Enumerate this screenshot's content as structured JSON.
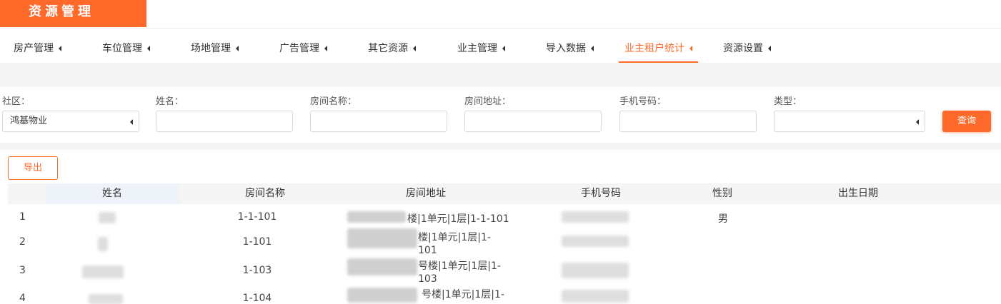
{
  "app": {
    "title": "资源管理"
  },
  "nav": [
    {
      "label": "房产管理",
      "active": false
    },
    {
      "label": "车位管理",
      "active": false
    },
    {
      "label": "场地管理",
      "active": false
    },
    {
      "label": "广告管理",
      "active": false
    },
    {
      "label": "其它资源",
      "active": false
    },
    {
      "label": "业主管理",
      "active": false
    },
    {
      "label": "导入数据",
      "active": false
    },
    {
      "label": "业主租户统计",
      "active": true
    },
    {
      "label": "资源设置",
      "active": false
    }
  ],
  "filters": {
    "community": {
      "label": "社区：",
      "value": "鸿基物业"
    },
    "name": {
      "label": "姓名：",
      "value": ""
    },
    "room_name": {
      "label": "房间名称：",
      "value": ""
    },
    "room_address": {
      "label": "房间地址：",
      "value": ""
    },
    "phone": {
      "label": "手机号码：",
      "value": ""
    },
    "type": {
      "label": "类型：",
      "value": ""
    },
    "query_label": "查询"
  },
  "export_label": "导出",
  "table": {
    "headers": [
      "姓名",
      "房间名称",
      "房间地址",
      "手机号码",
      "性别",
      "出生日期"
    ],
    "rows": [
      {
        "index": "1",
        "room_name": "1-1-101",
        "address_line1": "楼|1单元|1层|1-1-101",
        "address_line2": "",
        "gender": "男"
      },
      {
        "index": "2",
        "room_name": "1-101",
        "address_line1": "楼|1单元|1层|1-",
        "address_line2": "101",
        "gender": ""
      },
      {
        "index": "3",
        "room_name": "1-103",
        "address_line1": "号楼|1单元|1层|1-",
        "address_line2": "103",
        "gender": ""
      },
      {
        "index": "4",
        "room_name": "1-104",
        "address_line1": "号楼|1单元|1层|1-",
        "address_line2": "",
        "gender": ""
      }
    ]
  }
}
